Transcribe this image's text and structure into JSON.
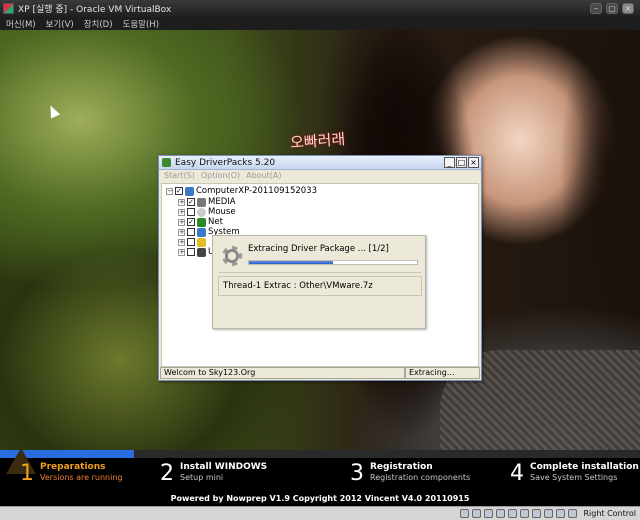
{
  "host": {
    "title": "XP [실행 중] - Oracle VM VirtualBox",
    "controls": [
      "–",
      "▢",
      "×"
    ],
    "menu": [
      "머신(M)",
      "보기(V)",
      "장치(D)",
      "도움말(H)"
    ],
    "status_label": "Right Control"
  },
  "wallpaper": {
    "overlay_text": "오빠러래"
  },
  "edp": {
    "title": "Easy DriverPacks 5.20",
    "controls": [
      "_",
      "□",
      "×"
    ],
    "menu": [
      "Start(S)",
      "Option(O)",
      "About(A)"
    ],
    "tree": {
      "root": "ComputerXP-201109152033",
      "children": [
        {
          "label": "MEDIA",
          "checked": true,
          "icon": "speaker-icon"
        },
        {
          "label": "Mouse",
          "checked": false,
          "icon": "mouse-icon"
        },
        {
          "label": "Net",
          "checked": true,
          "icon": "network-icon"
        },
        {
          "label": "System",
          "checked": false,
          "icon": "computer-icon"
        },
        {
          "label": "",
          "checked": false,
          "icon": "key-icon"
        },
        {
          "label": "U",
          "checked": false,
          "icon": "usb-icon"
        }
      ]
    },
    "status_left": "Welcom to Sky123.Org",
    "status_right": "Extracing..."
  },
  "popup": {
    "message": "Extracing Driver Package ... [1/2]",
    "progress": 0.5,
    "file_label": "Thread-1 Extrac : Other\\VMware.7z"
  },
  "setup": {
    "progress": 0.21,
    "steps": [
      {
        "num": "1",
        "title": "Preparations",
        "sub": "Versions are running",
        "active": true
      },
      {
        "num": "2",
        "title": "Install WINDOWS",
        "sub": "Setup mini",
        "active": false
      },
      {
        "num": "3",
        "title": "Registration",
        "sub": "Registration components",
        "active": false
      },
      {
        "num": "4",
        "title": "Complete installation",
        "sub": "Save System Settings",
        "active": false
      }
    ],
    "powered_by": "Powered by Nowprep V1.9  Copyright 2012 Vincent V4.0 20110915"
  },
  "colors": {
    "accent": "#2a6de0",
    "active_step": "#f0a020"
  }
}
